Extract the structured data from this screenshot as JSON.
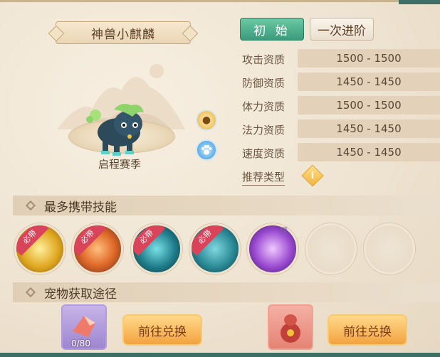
{
  "pet": {
    "name": "神兽小麒麟",
    "season": "启程赛季"
  },
  "tabs": [
    {
      "label": "初 始",
      "active": true
    },
    {
      "label": "一次进阶",
      "active": false
    }
  ],
  "stats": [
    {
      "label": "攻击资质",
      "value": "1500 - 1500"
    },
    {
      "label": "防御资质",
      "value": "1450 - 1450"
    },
    {
      "label": "体力资质",
      "value": "1500 - 1500"
    },
    {
      "label": "法力资质",
      "value": "1450 - 1450"
    },
    {
      "label": "速度资质",
      "value": "1450 - 1450"
    }
  ],
  "recommend": {
    "label": "推荐类型",
    "icon": "info-diamond-icon"
  },
  "skills_section": {
    "title": "最多携带技能"
  },
  "skills": [
    {
      "tag": "必带",
      "icon": "skill-gold-icon"
    },
    {
      "tag": "必带",
      "icon": "skill-fire-claw-icon"
    },
    {
      "tag": "必带",
      "icon": "skill-teal-icon"
    },
    {
      "tag": "必带",
      "icon": "skill-water-icon"
    },
    {
      "tag": "赋",
      "icon": "skill-purple-beast-icon"
    },
    {
      "tag": "",
      "icon": "empty-slot"
    },
    {
      "tag": "",
      "icon": "empty-slot"
    }
  ],
  "acquire_section": {
    "title": "宠物获取途径"
  },
  "acquire": [
    {
      "icon": "purple-crystal-item-icon",
      "count": "0/80",
      "button": "前往兑换"
    },
    {
      "icon": "red-gourd-item-icon",
      "button": "前往兑换"
    }
  ],
  "colors": {
    "accent_green": "#3a9b7b",
    "button_orange": "#f3a23e",
    "tag_red": "#d9445a"
  }
}
